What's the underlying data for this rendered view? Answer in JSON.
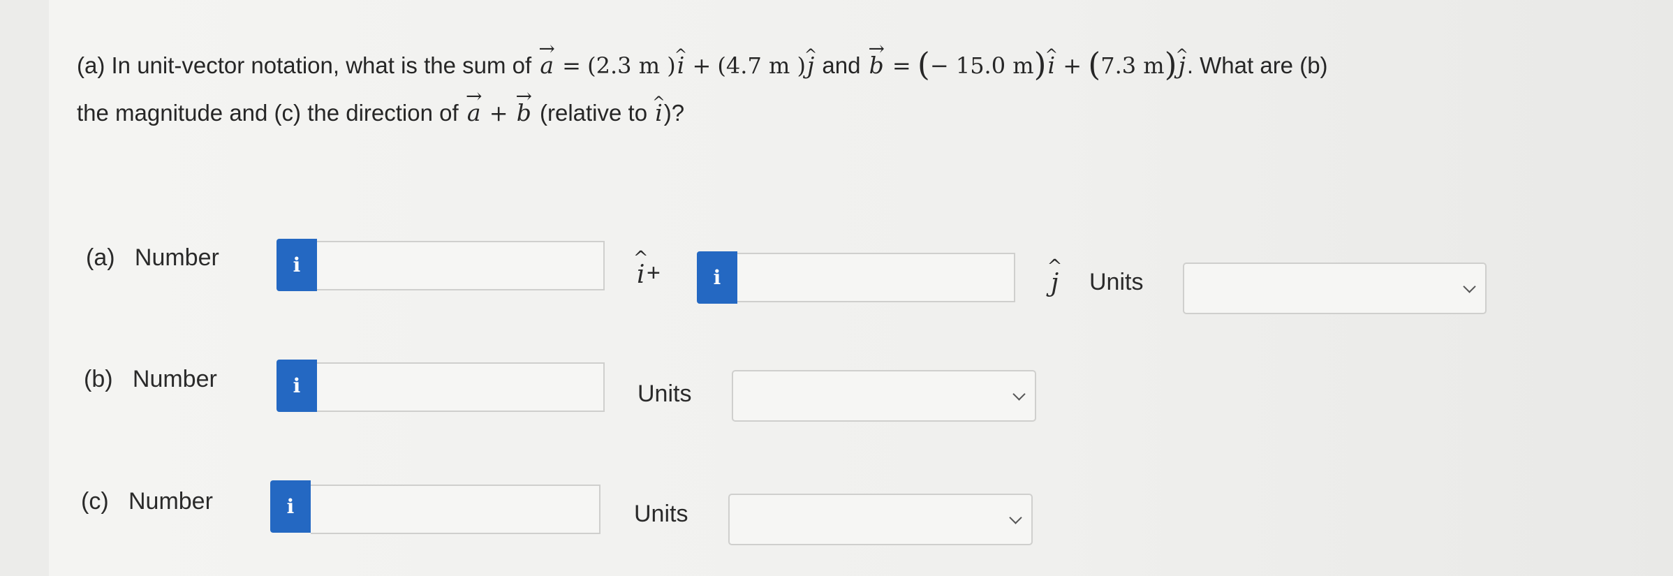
{
  "question": {
    "part_a_prefix": "(a) In unit-vector notation, what is the sum of",
    "vec_a": "a",
    "eq": "=",
    "a_x": "(2.3 m )",
    "plus": "+",
    "a_y": "(4.7 m )",
    "and_text": "and",
    "vec_b": "b",
    "b_x_val": "− 15.0 m",
    "b_y_val": "7.3 m",
    "i_hat": "i",
    "j_hat": "j",
    "what_are": ". What are (b)",
    "line2_prefix": "the magnitude and (c) the direction of",
    "relative": "(relative to",
    "relative_end": ")?"
  },
  "rows": {
    "a": {
      "label": "(a)   Number",
      "info": "i",
      "i_plus": "+",
      "i_sym": "i",
      "j_sym": "j",
      "units": "Units",
      "value_x": "",
      "value_y": "",
      "unit_value": ""
    },
    "b": {
      "label": "(b)   Number",
      "info": "i",
      "units": "Units",
      "value": "",
      "unit_value": ""
    },
    "c": {
      "label": "(c)   Number",
      "info": "i",
      "units": "Units",
      "value": "",
      "unit_value": ""
    }
  }
}
